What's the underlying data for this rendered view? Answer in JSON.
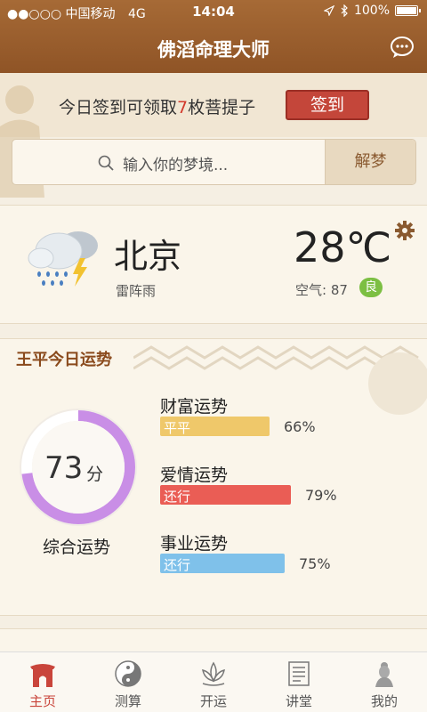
{
  "status_bar": {
    "carrier": "●●○○○ 中国移动",
    "network": "4G",
    "time": "14:04",
    "battery": "100%"
  },
  "nav": {
    "title": "佛滔命理大师"
  },
  "signin": {
    "text_before": "今日签到可领取",
    "count": "7",
    "text_after": "枚菩提子",
    "button_label": "签到"
  },
  "search": {
    "placeholder": "输入你的梦境...",
    "button_label": "解梦"
  },
  "weather": {
    "city": "北京",
    "condition": "雷阵雨",
    "temperature": "28℃",
    "air_label": "空气: 87",
    "air_quality": "良"
  },
  "fortune": {
    "title": "王平今日运势",
    "score": "73",
    "score_unit": "分",
    "score_fraction": 0.73,
    "score_label": "综合运势",
    "items": [
      {
        "label": "财富运势",
        "tag": "平平",
        "percent": "66%",
        "value": 66,
        "color": "#efc86a"
      },
      {
        "label": "爱情运势",
        "tag": "还行",
        "percent": "79%",
        "value": 79,
        "color": "#ea5d55"
      },
      {
        "label": "事业运势",
        "tag": "还行",
        "percent": "75%",
        "value": 75,
        "color": "#7fc1ea"
      }
    ]
  },
  "tabs": [
    {
      "label": "主页",
      "icon": "home-icon",
      "active": true
    },
    {
      "label": "测算",
      "icon": "yinyang-icon",
      "active": false
    },
    {
      "label": "开运",
      "icon": "lotus-icon",
      "active": false
    },
    {
      "label": "讲堂",
      "icon": "book-icon",
      "active": false
    },
    {
      "label": "我的",
      "icon": "buddha-icon",
      "active": false
    }
  ],
  "colors": {
    "brand": "#9a5c2c",
    "accent": "#c9453b",
    "gauge": "#c98ee6"
  }
}
